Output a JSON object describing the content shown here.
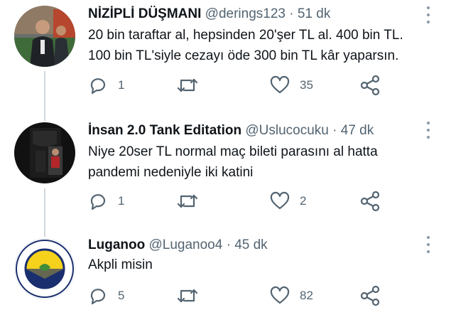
{
  "tweets": [
    {
      "name": "NİZİPLİ DÜŞMANI",
      "handle": "@derings123",
      "dot": "·",
      "time": "51 dk",
      "lines": [
        "20 bin taraftar al, hepsinden 20'şer TL al. 400 bin TL.",
        "100 bin TL'siyle cezayı öde 300 bin TL kâr yaparsın."
      ],
      "replies": "1",
      "retweets": "",
      "likes": "35"
    },
    {
      "name": "İnsan 2.0 Tank Editation",
      "handle": "@Uslucocuku",
      "dot": "·",
      "time": "47 dk",
      "lines": [
        "Niye 20ser TL normal maç bileti parasını al hatta",
        "pandemi nedeniyle iki katini"
      ],
      "replies": "1",
      "retweets": "",
      "likes": "2"
    },
    {
      "name": "Luganoo",
      "handle": "@Luganoo4",
      "dot": "·",
      "time": "45 dk",
      "lines": [
        "Akpli misin"
      ],
      "replies": "5",
      "retweets": "",
      "likes": "82"
    }
  ],
  "icons": {
    "reply": "reply-icon",
    "retweet": "retweet-icon",
    "like": "heart-icon",
    "share": "share-icon",
    "more": "more-icon"
  },
  "colors": {
    "text": "#0f1419",
    "secondary": "#536471",
    "thread_line": "#cfd9de",
    "icon": "#536471",
    "logo_yellow": "#f6d21d",
    "logo_navy": "#1a2f6e"
  },
  "logo_text": {
    "ring": "FENERBAHÇE SPOR KULÜBÜ",
    "year": "1907"
  }
}
